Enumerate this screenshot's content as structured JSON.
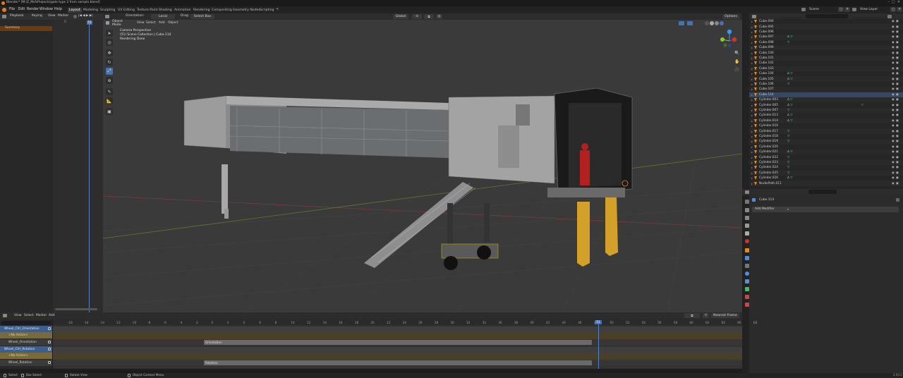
{
  "window": {
    "title": "Blender* [M:\\Z_MsfsProjects\\gate type 2 from sample.blend]"
  },
  "topbar": {
    "menus": [
      "File",
      "Edit",
      "Render",
      "Window",
      "Help"
    ],
    "workspaces": [
      "Layout",
      "Modeling",
      "Sculpting",
      "UV Editing",
      "Texture Paint",
      "Shading",
      "Animation",
      "Rendering",
      "Compositing",
      "Geometry Nodes",
      "Scripting"
    ],
    "active_workspace": "Layout",
    "scene_label": "Scene",
    "view_layer_label": "View Layer"
  },
  "left_timeline": {
    "menus": [
      "Playback",
      "Keying",
      "View",
      "Marker"
    ],
    "frame_field": "51",
    "summary": "Summary",
    "start_field": "0"
  },
  "viewport": {
    "orientation_label": "Orientation:",
    "orientation_value": "Local",
    "global_value": "Global",
    "drag_label": "Drag:",
    "drag_value": "Select Box",
    "mode": "Object Mode",
    "menus": [
      "View",
      "Select",
      "Add",
      "Object"
    ],
    "options": "Options",
    "info_line1": "Camera Perspective",
    "info_line2": "(51) Scene Collection | Cube.114",
    "info_line3": "Rendering Done"
  },
  "outliner": {
    "rows": [
      {
        "name": "Cube.094",
        "mods": "",
        "mat": false
      },
      {
        "name": "Cube.095",
        "mods": "",
        "mat": false
      },
      {
        "name": "Cube.096",
        "mods": "",
        "mat": false
      },
      {
        "name": "Cube.097",
        "mods": "∆ ▽",
        "mat": false
      },
      {
        "name": "Cube.098",
        "mods": "▽",
        "mat": false
      },
      {
        "name": "Cube.099",
        "mods": "",
        "mat": false
      },
      {
        "name": "Cube.100",
        "mods": "",
        "mat": false
      },
      {
        "name": "Cube.101",
        "mods": "",
        "mat": false
      },
      {
        "name": "Cube.102",
        "mods": "",
        "mat": false
      },
      {
        "name": "Cube.103",
        "mods": "",
        "mat": false
      },
      {
        "name": "Cube.104",
        "mods": "∆ ▽",
        "mat": false
      },
      {
        "name": "Cube.105",
        "mods": "∆ ▽",
        "mat": false
      },
      {
        "name": "Cube.106",
        "mods": "▽",
        "mat": false
      },
      {
        "name": "Cube.107",
        "mods": "",
        "mat": false
      },
      {
        "name": "Cube.114",
        "mods": "",
        "mat": false
      },
      {
        "name": "Cylinder.003",
        "mods": "∆ ▽",
        "mat": false
      },
      {
        "name": "Cylinder.005",
        "mods": "∆ ▽",
        "mat": true
      },
      {
        "name": "Cylinder.007",
        "mods": "▽",
        "mat": false
      },
      {
        "name": "Cylinder.013",
        "mods": "∆ ▽",
        "mat": false
      },
      {
        "name": "Cylinder.014",
        "mods": "∆ ▽",
        "mat": false
      },
      {
        "name": "Cylinder.016",
        "mods": "",
        "mat": false
      },
      {
        "name": "Cylinder.017",
        "mods": "▽",
        "mat": false
      },
      {
        "name": "Cylinder.018",
        "mods": "▽",
        "mat": false
      },
      {
        "name": "Cylinder.019",
        "mods": "▽",
        "mat": false
      },
      {
        "name": "Cylinder.020",
        "mods": "",
        "mat": false
      },
      {
        "name": "Cylinder.021",
        "mods": "∆ ▽",
        "mat": false
      },
      {
        "name": "Cylinder.022",
        "mods": "▽",
        "mat": false
      },
      {
        "name": "Cylinder.023",
        "mods": "▽",
        "mat": false
      },
      {
        "name": "Cylinder.024",
        "mods": "▽",
        "mat": false
      },
      {
        "name": "Cylinder.025",
        "mods": "▽",
        "mat": false
      },
      {
        "name": "Cylinder.026",
        "mods": "∆ ▽",
        "mat": false
      },
      {
        "name": "NurbsPath.011",
        "mods": "",
        "mat": false
      }
    ]
  },
  "properties": {
    "object_name": "Cube.114",
    "add_modifier": "Add Modifier"
  },
  "nla": {
    "menus": [
      "View",
      "Select",
      "Marker",
      "Add"
    ],
    "nearest_frame": "Nearest Frame",
    "tracks": [
      {
        "name": "Wheel_Ctrl_Orientation",
        "kind": "object"
      },
      {
        "name": "<No Action>",
        "kind": "noaction"
      },
      {
        "name": "Wheel_Orientation",
        "kind": "track"
      },
      {
        "name": "Wheel_Ctrl_Rotation",
        "kind": "object"
      },
      {
        "name": "<No Action>",
        "kind": "noaction"
      },
      {
        "name": "Wheel_Rotation",
        "kind": "track"
      }
    ],
    "strip1": "Orientation",
    "strip2": "Rotation",
    "current_frame": "51",
    "ruler": [
      "-18",
      "-16",
      "-14",
      "-12",
      "-10",
      "-8",
      "-6",
      "-4",
      "-2",
      "0",
      "2",
      "4",
      "6",
      "8",
      "10",
      "12",
      "14",
      "16",
      "18",
      "20",
      "22",
      "24",
      "26",
      "28",
      "30",
      "32",
      "34",
      "36",
      "38",
      "40",
      "42",
      "44",
      "46",
      "48",
      "50",
      "52",
      "54",
      "56",
      "58",
      "60",
      "62",
      "64",
      "66",
      "68"
    ]
  },
  "statusbar": {
    "select": "Select",
    "box_select": "Box Select",
    "rotate_view": "Rotate View",
    "context_menu": "Object Context Menu",
    "version": "2.93.5"
  },
  "colors": {
    "accent": "#4772b3",
    "orange": "#e58a1a",
    "summary_bg": "#6b3a10",
    "timeline_playhead": "#5680c2",
    "grid_red": "#8a3a3a",
    "grid_green": "#5a7a2a"
  }
}
